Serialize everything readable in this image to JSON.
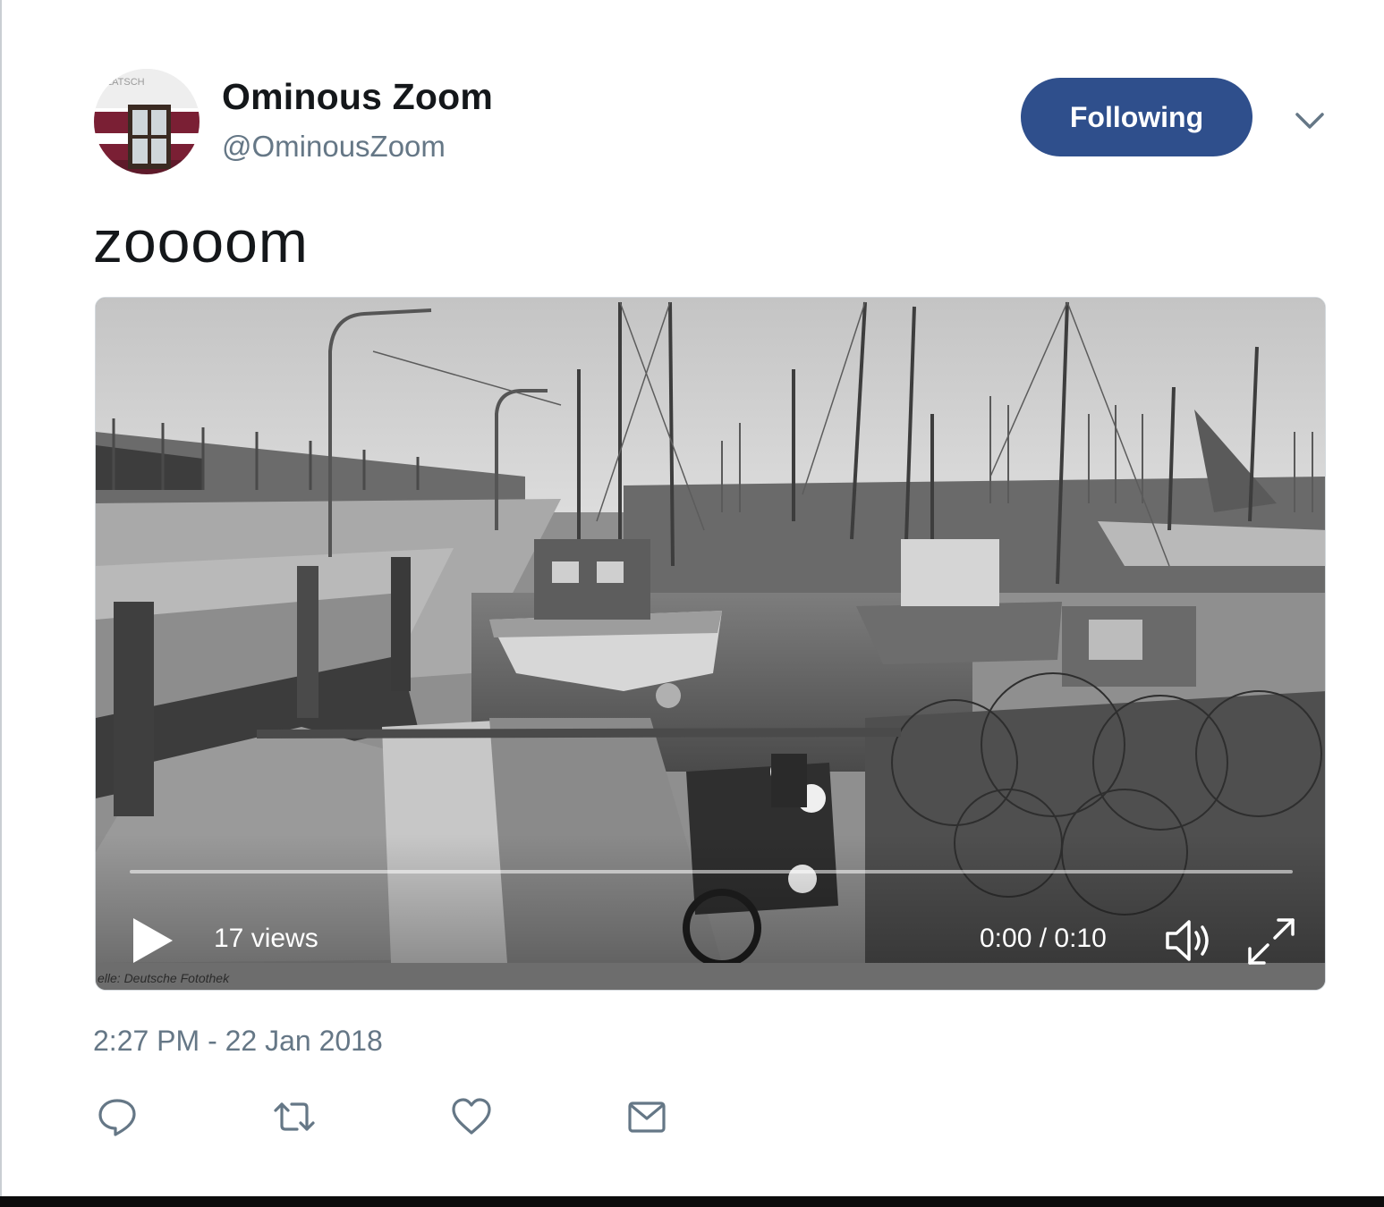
{
  "user": {
    "display_name": "Ominous Zoom",
    "handle": "@OminousZoom",
    "avatar_text": "LATSCH"
  },
  "follow_button": {
    "label": "Following",
    "color": "#2f4f8c"
  },
  "menu": {
    "icon": "chevron-down-icon"
  },
  "tweet": {
    "text": "zoooom",
    "timestamp": "2:27 PM - 22 Jan 2018"
  },
  "video": {
    "views": "17 views",
    "time": "0:00 / 0:10",
    "credit": "elle: Deutsche Fotothek",
    "progress": 0,
    "icons": [
      "play-icon",
      "volume-icon",
      "fullscreen-icon"
    ]
  },
  "actions": [
    {
      "name": "reply",
      "icon": "reply-icon"
    },
    {
      "name": "retweet",
      "icon": "retweet-icon"
    },
    {
      "name": "like",
      "icon": "heart-icon"
    },
    {
      "name": "message",
      "icon": "envelope-icon"
    }
  ],
  "colors": {
    "text": "#14171a",
    "secondary": "#657786",
    "icon": "#657786"
  }
}
